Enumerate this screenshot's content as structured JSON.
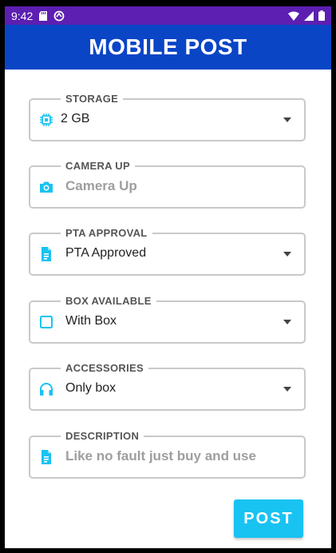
{
  "status_bar": {
    "time": "9:42"
  },
  "app_bar": {
    "title": "MOBILE POST"
  },
  "form": {
    "fields": [
      {
        "label": "STORAGE",
        "value": "2 GB",
        "icon": "chip-icon"
      },
      {
        "label": "CAMERA UP",
        "placeholder": "Camera Up",
        "icon": "camera-icon"
      },
      {
        "label": "PTA APPROVAL",
        "value": "PTA Approved",
        "icon": "document-icon"
      },
      {
        "label": "BOX AVAILABLE",
        "value": "With Box",
        "icon": "checkbox-icon"
      },
      {
        "label": "ACCESSORIES",
        "value": "Only box",
        "icon": "headphones-icon"
      },
      {
        "label": "DESCRIPTION",
        "placeholder": "Like no fault just buy and use",
        "icon": "document-icon"
      }
    ]
  },
  "post_button": {
    "label": "POST"
  },
  "colors": {
    "status_bar": "#5c1fb1",
    "app_bar": "#0a45c6",
    "accent": "#18c3f2"
  }
}
